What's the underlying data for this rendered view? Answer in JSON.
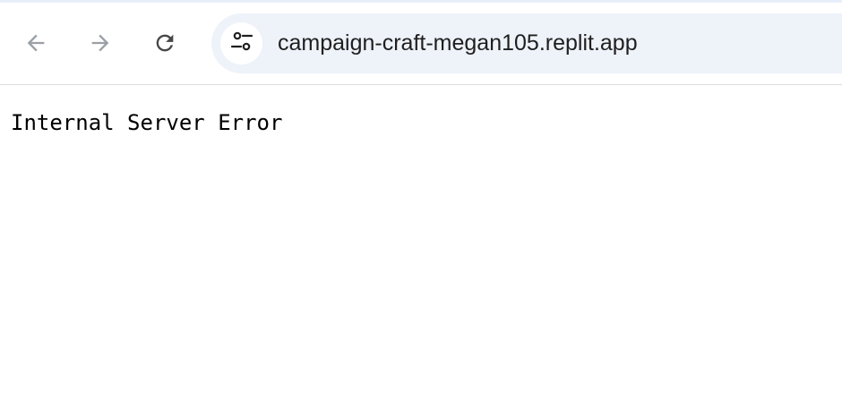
{
  "browser": {
    "address_bar": {
      "url": "campaign-craft-megan105.replit.app"
    },
    "icons": {
      "back": "arrow-left-icon",
      "forward": "arrow-right-icon",
      "reload": "reload-icon",
      "site_info": "tune-icon"
    },
    "colors": {
      "toolbar_bg": "#ffffff",
      "omnibox_bg": "#eef2f9",
      "icon_disabled": "#9aa0a6",
      "icon_active": "#474747"
    }
  },
  "page": {
    "body_text": "Internal Server Error"
  }
}
